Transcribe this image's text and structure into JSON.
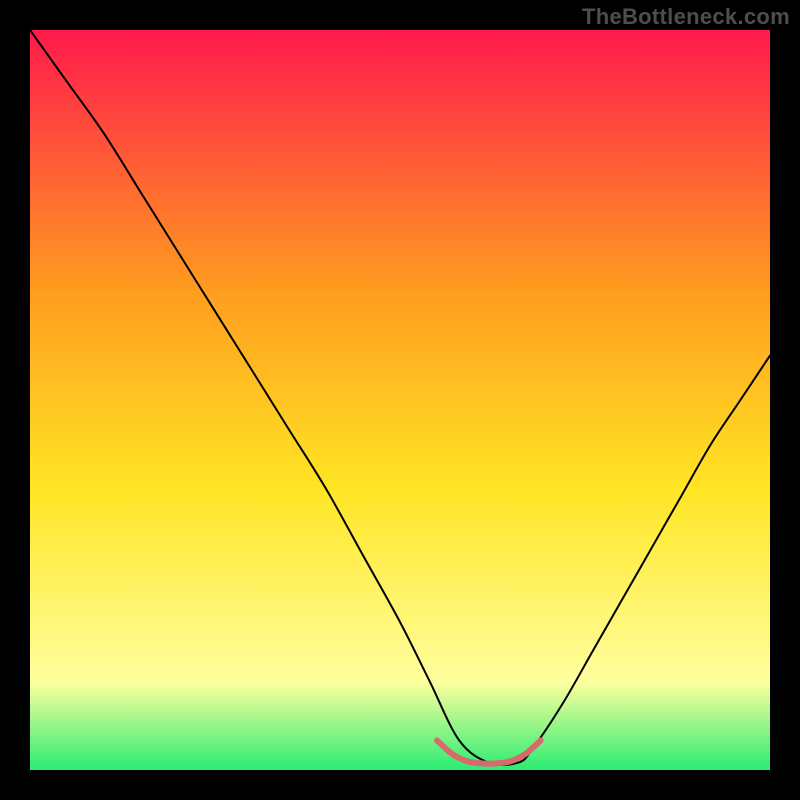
{
  "watermark": "TheBottleneck.com",
  "chart_data": {
    "type": "line",
    "title": "",
    "xlabel": "",
    "ylabel": "",
    "xlim": [
      0,
      100
    ],
    "ylim": [
      0,
      100
    ],
    "grid": false,
    "legend": false,
    "background_gradient": {
      "top": "#ff1a4b",
      "mid1": "#ff9c1f",
      "mid2": "#ffe524",
      "near_bottom": "#ffff9e",
      "bottom": "#2bec73"
    },
    "series": [
      {
        "name": "bottleneck-curve",
        "color": "#000000",
        "thickness": 2,
        "x": [
          0,
          5,
          10,
          15,
          20,
          25,
          30,
          35,
          40,
          45,
          50,
          54,
          58,
          62,
          66,
          68,
          72,
          76,
          80,
          84,
          88,
          92,
          96,
          100
        ],
        "y": [
          100,
          93,
          86,
          78,
          70,
          62,
          54,
          46,
          38,
          29,
          20,
          12,
          4,
          1,
          1,
          3,
          9,
          16,
          23,
          30,
          37,
          44,
          50,
          56
        ]
      },
      {
        "name": "sweet-spot-band",
        "color": "#d86a6e",
        "thickness": 6,
        "x": [
          55,
          57,
          59,
          61,
          63,
          65,
          67,
          69
        ],
        "y": [
          4,
          2.2,
          1.2,
          0.9,
          0.9,
          1.2,
          2.2,
          4
        ]
      }
    ]
  }
}
